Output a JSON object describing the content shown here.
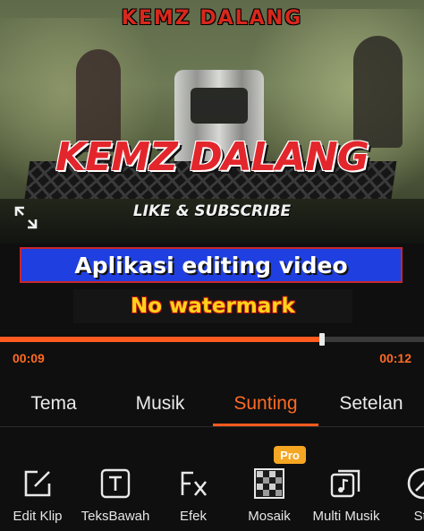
{
  "preview": {
    "top_title": "KEMZ DALANG",
    "big_title": "KEMZ DALANG",
    "sub_title": "LIKE & SUBSCRIBE",
    "expand_icon": "expand-icon"
  },
  "banners": {
    "line1": "Aplikasi editing video",
    "line2": "No watermark"
  },
  "timeline": {
    "current_time": "00:09",
    "total_time": "00:12",
    "progress": 0.76,
    "accent_color": "#ff5a1f"
  },
  "tabs": [
    {
      "label": "Tema",
      "active": false
    },
    {
      "label": "Musik",
      "active": false
    },
    {
      "label": "Sunting",
      "active": true
    },
    {
      "label": "Setelan",
      "active": false
    }
  ],
  "tools": [
    {
      "label": "Edit Klip",
      "icon": "edit-icon"
    },
    {
      "label": "TeksBawah",
      "icon": "text-icon"
    },
    {
      "label": "Efek",
      "icon": "fx-icon"
    },
    {
      "label": "Mosaik",
      "icon": "mosaic-icon",
      "badge": "Pro"
    },
    {
      "label": "Multi Musik",
      "icon": "music-icon"
    },
    {
      "label": "Stil",
      "icon": "sticker-icon"
    }
  ]
}
